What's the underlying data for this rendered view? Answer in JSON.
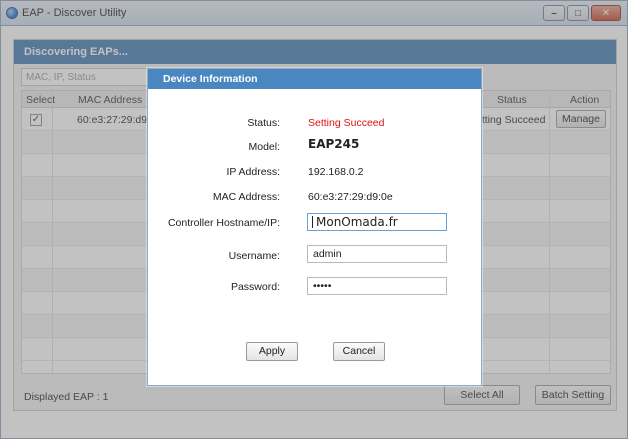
{
  "window": {
    "title": "EAP - Discover Utility",
    "minimize": "–",
    "maximize": "□",
    "close": "✕"
  },
  "panel": {
    "header": "Discovering EAPs...",
    "filter_placeholder": "MAC, IP, Status",
    "columns": {
      "select": "Select",
      "mac": "MAC Address",
      "status": "Status",
      "action": "Action"
    },
    "row": {
      "checked": "✓",
      "mac": "60:e3:27:29:d9:0e",
      "status": "etting Succeed",
      "action": "Manage"
    },
    "displayed": "Displayed EAP : 1",
    "select_all": "Select All",
    "batch_setting": "Batch Setting"
  },
  "modal": {
    "title": "Device Information",
    "labels": {
      "status": "Status:",
      "model": "Model:",
      "ip": "IP Address:",
      "mac": "MAC Address:",
      "controller": "Controller Hostname/IP:",
      "username": "Username:",
      "password": "Password:"
    },
    "values": {
      "status": "Setting Succeed",
      "model": "EAP245",
      "ip": "192.168.0.2",
      "mac": "60:e3:27:29:d9:0e",
      "controller": "MonOmada.fr",
      "username": "admin",
      "password": "•••••"
    },
    "apply": "Apply",
    "cancel": "Cancel"
  },
  "colors": {
    "panel_header": "#3f79b2",
    "modal_header": "#4a86c0",
    "status_red": "#e01010"
  },
  "icons": {
    "app": "omada-app-icon"
  }
}
